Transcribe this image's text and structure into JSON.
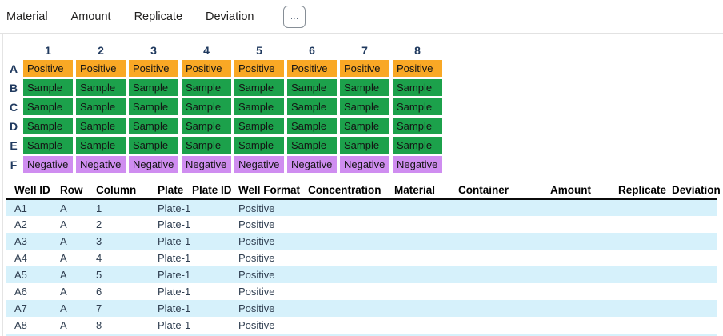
{
  "toolbar": {
    "tabs": [
      {
        "label": "Material"
      },
      {
        "label": "Amount"
      },
      {
        "label": "Replicate"
      },
      {
        "label": "Deviation"
      }
    ],
    "more_button_label": "..."
  },
  "plate": {
    "column_headers": [
      "1",
      "2",
      "3",
      "4",
      "5",
      "6",
      "7",
      "8"
    ],
    "rows": [
      {
        "label": "A",
        "cell_text": "Positive",
        "cell_color": "#F9A825"
      },
      {
        "label": "B",
        "cell_text": "Sample",
        "cell_color": "#1CA14B"
      },
      {
        "label": "C",
        "cell_text": "Sample",
        "cell_color": "#1CA14B"
      },
      {
        "label": "D",
        "cell_text": "Sample",
        "cell_color": "#1CA14B"
      },
      {
        "label": "E",
        "cell_text": "Sample",
        "cell_color": "#1CA14B"
      },
      {
        "label": "F",
        "cell_text": "Negative",
        "cell_color": "#CF8DF0"
      }
    ]
  },
  "table": {
    "headers": [
      "Well ID",
      "Row",
      "Column",
      "Plate",
      "Plate ID",
      "Well Format",
      "Concentration",
      "Material",
      "Container",
      "Amount",
      "Replicate",
      "Deviation"
    ],
    "rows": [
      [
        "A1",
        "A",
        "1",
        "Plate-1",
        "",
        "Positive",
        "",
        "",
        "",
        "",
        "",
        ""
      ],
      [
        "A2",
        "A",
        "2",
        "Plate-1",
        "",
        "Positive",
        "",
        "",
        "",
        "",
        "",
        ""
      ],
      [
        "A3",
        "A",
        "3",
        "Plate-1",
        "",
        "Positive",
        "",
        "",
        "",
        "",
        "",
        ""
      ],
      [
        "A4",
        "A",
        "4",
        "Plate-1",
        "",
        "Positive",
        "",
        "",
        "",
        "",
        "",
        ""
      ],
      [
        "A5",
        "A",
        "5",
        "Plate-1",
        "",
        "Positive",
        "",
        "",
        "",
        "",
        "",
        ""
      ],
      [
        "A6",
        "A",
        "6",
        "Plate-1",
        "",
        "Positive",
        "",
        "",
        "",
        "",
        "",
        ""
      ],
      [
        "A7",
        "A",
        "7",
        "Plate-1",
        "",
        "Positive",
        "",
        "",
        "",
        "",
        "",
        ""
      ],
      [
        "A8",
        "A",
        "8",
        "Plate-1",
        "",
        "Positive",
        "",
        "",
        "",
        "",
        "",
        ""
      ]
    ]
  },
  "colors": {
    "positive_orange": "#F9A825",
    "sample_green": "#1CA14B",
    "negative_purple": "#CF8DF0",
    "table_alt_row": "#D6F1FB",
    "plate_label_navy": "#203A5F"
  }
}
